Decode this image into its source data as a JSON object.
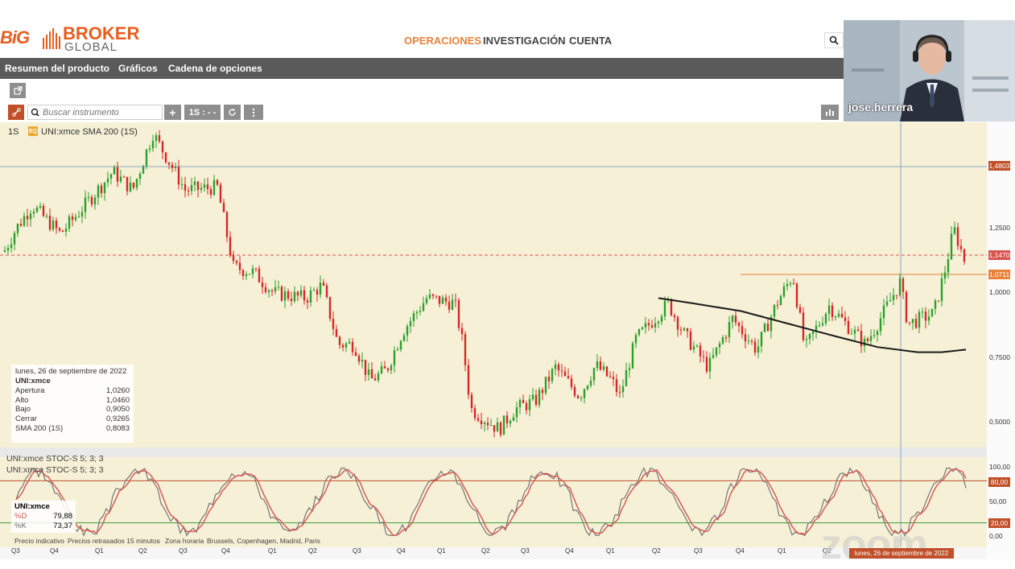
{
  "header": {
    "logo_big": "BiG",
    "logo_broker": "BROKER",
    "logo_global": "GLOBAL",
    "nav": [
      "OPERACIONES",
      "INVESTIGACIÓN",
      "CUENTA"
    ],
    "brand_color": "#e85d1f"
  },
  "subnav": {
    "tabs": [
      "Resumen del producto",
      "Gráficos",
      "Cadena de opciones"
    ]
  },
  "toolbar": {
    "search_placeholder": "Buscar instrumento",
    "plus": "+",
    "interval": "1S : - -"
  },
  "chart": {
    "interval_label": "1S",
    "eq_tag": "EQ",
    "instrument_label": "UNI:xmce  SMA 200 (1S)",
    "price_tags": [
      "1,4803",
      "1,1470",
      "1,0711"
    ],
    "y_axis": [
      "1,2500",
      "1,0000",
      "0,7500",
      "0,5000"
    ],
    "stoch_axis": [
      "100,00",
      "80,00",
      "50,00",
      "20,00",
      "0,00"
    ],
    "stoch_tags": [
      "80,00",
      "20,00"
    ],
    "x_axis": [
      "Q3",
      "Q4",
      "Q1",
      "Q2",
      "Q3",
      "Q4",
      "Q1",
      "Q2",
      "Q3",
      "Q4",
      "Q1",
      "Q2",
      "Q3",
      "Q4",
      "Q1",
      "Q2",
      "Q3",
      "Q4",
      "Q1",
      "Q2"
    ],
    "infobox": {
      "date": "lunes, 26 de septiembre de 2022",
      "symbol": "UNI:xmce",
      "rows": [
        {
          "label": "Apertura",
          "value": "1,0260"
        },
        {
          "label": "Alto",
          "value": "1,0460"
        },
        {
          "label": "Bajo",
          "value": "0,9050"
        },
        {
          "label": "Cerrar",
          "value": "0,9265"
        },
        {
          "label": "SMA 200 (1S)",
          "value": "0,8083"
        }
      ]
    },
    "stoch_title_1": "UNI:xmce  STOC-S 5; 3; 3",
    "stoch_title_2": "UNI:xmce  STOC-S 5; 3; 3",
    "stoch_box": {
      "symbol": "UNI:xmce",
      "rows": [
        {
          "label": "%D",
          "value": "79,88"
        },
        {
          "label": "%K",
          "value": "73,37"
        }
      ]
    },
    "footer": {
      "indicative": "Precio indicativo",
      "delay": "Precios retrasados 15 minutos",
      "tz_label": "Zona horaria",
      "tz_value": "Brussels, Copenhagen, Madrid, Paris"
    },
    "date_strip": "lunes, 26 de septiembre de 2022",
    "colors": {
      "up": "#2ca02c",
      "down": "#d62728",
      "bg": "#f5f0d6",
      "sma": "#1a1a1a",
      "stoch_d": "#d9534f",
      "stoch_k": "#777777"
    }
  },
  "video": {
    "name": "jose.herrera",
    "watermark": "zoom"
  }
}
